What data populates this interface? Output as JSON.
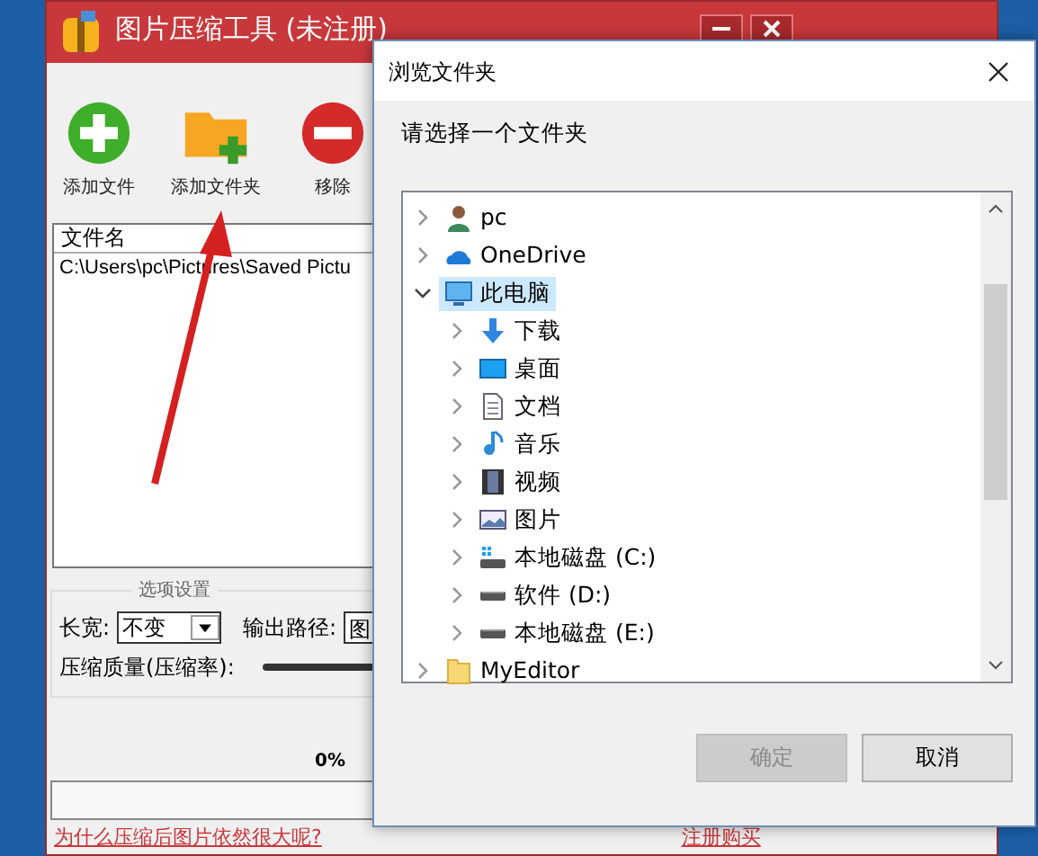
{
  "main_window": {
    "title": "图片压缩工具 (未注册)",
    "toolbar": [
      {
        "kind": "add-file",
        "label": "添加文件"
      },
      {
        "kind": "add-folder",
        "label": "添加文件夹"
      },
      {
        "kind": "remove",
        "label": "移除"
      }
    ],
    "file_list": {
      "columns": [
        "文件名"
      ],
      "rows": [
        [
          "C:\\Users\\pc\\Pictures\\Saved Pictu"
        ]
      ]
    },
    "options": {
      "legend": "选项设置",
      "size_label": "长宽:",
      "size_value": "不变",
      "output_label": "输出路径:",
      "output_value": "图",
      "quality_label": "压缩质量(压缩率):"
    },
    "progress": {
      "reading": "0%",
      "level": 0
    },
    "help_link": "为什么压缩后图片依然很大呢?",
    "register_link": "注册购买"
  },
  "dialog": {
    "title": "浏览文件夹",
    "prompt": "请选择一个文件夹",
    "tree": [
      {
        "label": "pc",
        "kind": "user",
        "expanded": false,
        "selected": false
      },
      {
        "label": "OneDrive",
        "kind": "cloud",
        "expanded": false,
        "selected": false
      },
      {
        "label": "此电脑",
        "kind": "computer",
        "expanded": true,
        "selected": true,
        "children": [
          {
            "label": "下载",
            "kind": "download",
            "expanded": false,
            "selected": false
          },
          {
            "label": "桌面",
            "kind": "desktop",
            "expanded": false,
            "selected": false
          },
          {
            "label": "文档",
            "kind": "document",
            "expanded": false,
            "selected": false
          },
          {
            "label": "音乐",
            "kind": "music",
            "expanded": false,
            "selected": false
          },
          {
            "label": "视频",
            "kind": "video",
            "expanded": false,
            "selected": false
          },
          {
            "label": "图片",
            "kind": "pictures",
            "expanded": false,
            "selected": false
          },
          {
            "label": "本地磁盘 (C:)",
            "kind": "system-drive",
            "expanded": false,
            "selected": false
          },
          {
            "label": "软件 (D:)",
            "kind": "drive",
            "expanded": false,
            "selected": false
          },
          {
            "label": "本地磁盘 (E:)",
            "kind": "drive",
            "expanded": false,
            "selected": false
          }
        ]
      },
      {
        "label": "MyEditor",
        "kind": "folder",
        "expanded": false,
        "selected": false
      }
    ],
    "buttons": [
      {
        "label": "确定",
        "disabled": true
      },
      {
        "label": "取消",
        "disabled": false
      }
    ]
  }
}
